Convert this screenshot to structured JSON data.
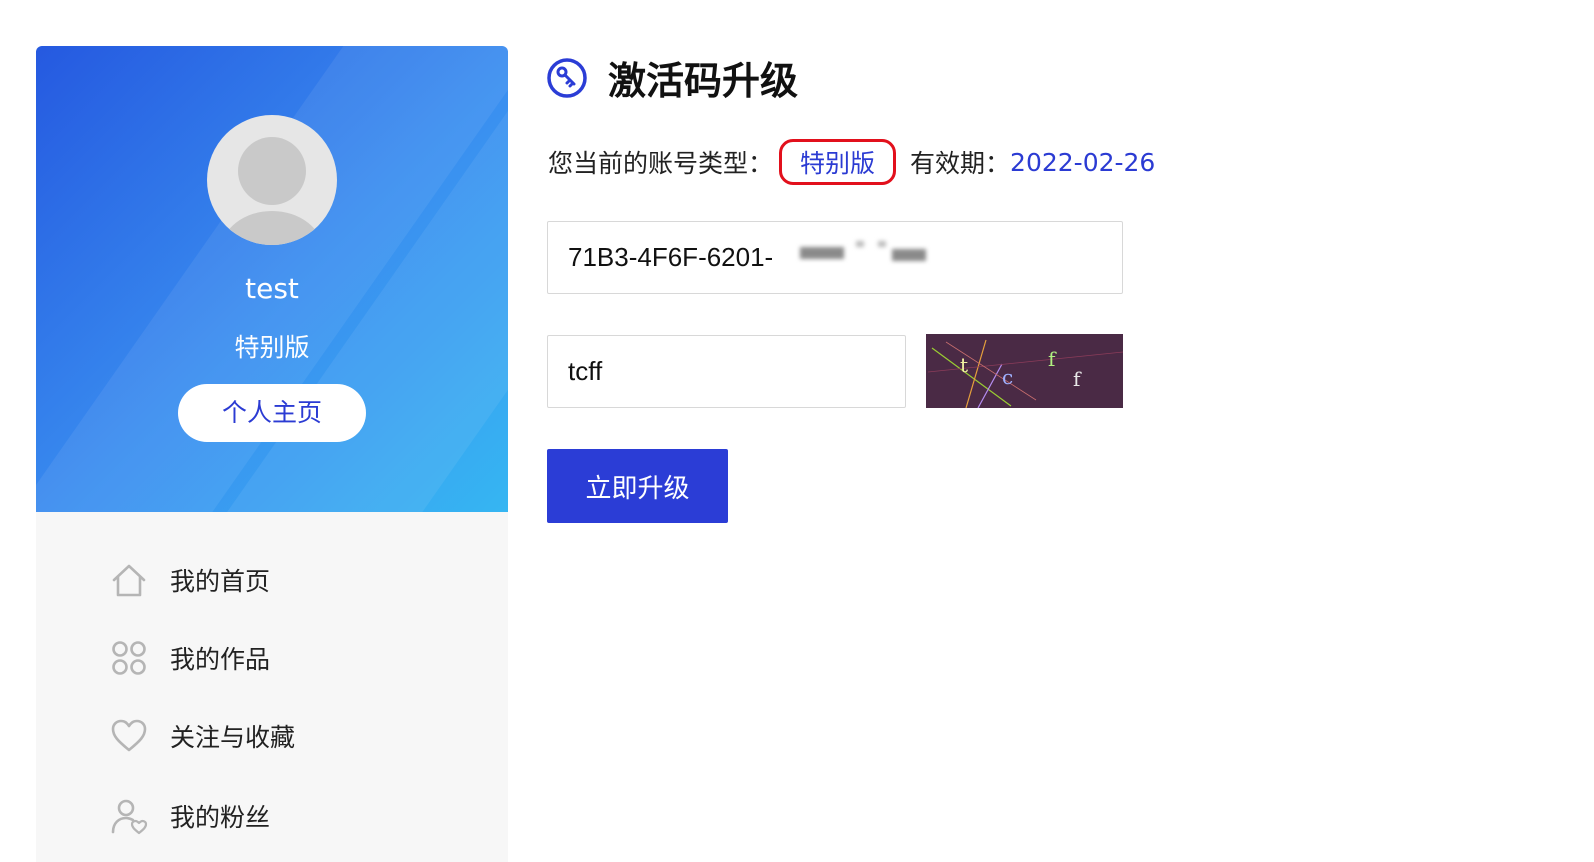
{
  "profile": {
    "username": "test",
    "edition": "特别版",
    "home_button": "个人主页"
  },
  "menu": [
    {
      "label": "我的首页",
      "icon": "home-icon"
    },
    {
      "label": "我的作品",
      "icon": "grid-icon"
    },
    {
      "label": "关注与收藏",
      "icon": "heart-icon"
    },
    {
      "label": "我的粉丝",
      "icon": "user-heart-icon"
    }
  ],
  "main": {
    "title": "激活码升级",
    "title_icon": "key-badge-icon",
    "account_type_label": "您当前的账号类型：",
    "account_type": "特别版",
    "expiry_label": "有效期：",
    "expiry_date": "2022-02-26",
    "activation_code": "71B3-4F6F-6201-",
    "captcha_value": "tcff",
    "captcha_text": "tcff",
    "submit_label": "立即升级"
  },
  "colors": {
    "accent": "#2b3dd6",
    "highlight_border": "#e2101c",
    "captcha_bg": "#4a2a45"
  }
}
